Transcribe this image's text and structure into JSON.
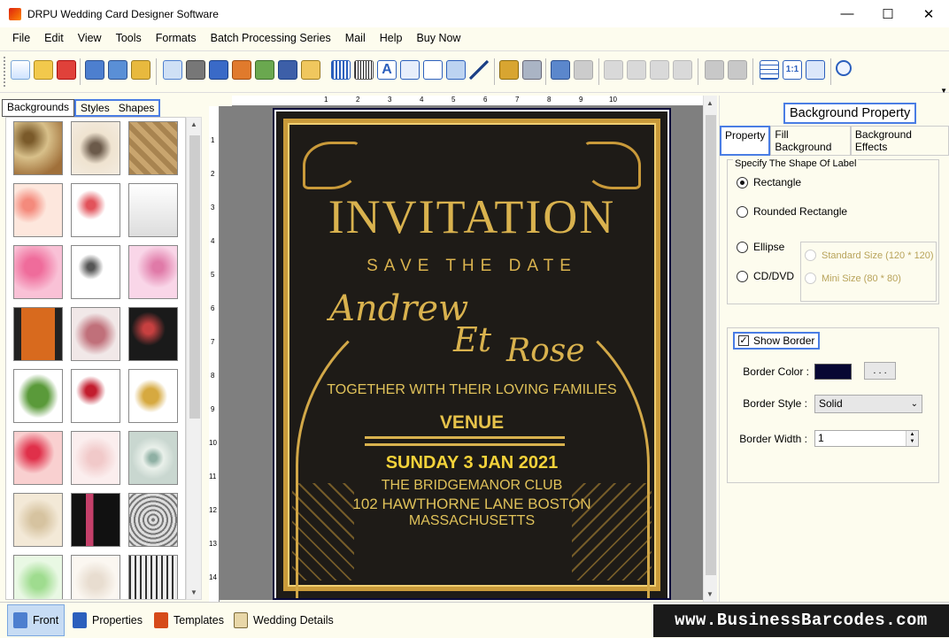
{
  "window": {
    "title": "DRPU Wedding Card Designer Software",
    "minimize": "—",
    "maximize": "☐",
    "close": "✕"
  },
  "menu": [
    "File",
    "Edit",
    "View",
    "Tools",
    "Formats",
    "Batch Processing Series",
    "Mail",
    "Help",
    "Buy Now"
  ],
  "left_tabs": [
    "Backgrounds",
    "Styles",
    "Shapes"
  ],
  "card": {
    "heading": "INVITATION",
    "subheading": "SAVE THE DATE",
    "name1": "Andrew",
    "conjunction": "Et",
    "name2": "Rose",
    "line1": "TOGETHER WITH THEIR LOVING FAMILIES",
    "venue_label": "VENUE",
    "date": "SUNDAY 3 JAN 2021",
    "address1": "THE BRIDGEMANOR CLUB",
    "address2": "102 HAWTHORNE LANE BOSTON",
    "address3": "MASSACHUSETTS",
    "colors": {
      "gold": "#d9b24e",
      "yellow": "#f3d23a",
      "bg": "#1e1b17",
      "border": "#070733"
    }
  },
  "ruler_h": [
    "1",
    "2",
    "3",
    "4",
    "5",
    "6",
    "7",
    "8",
    "9",
    "10"
  ],
  "ruler_v": [
    "1",
    "2",
    "3",
    "4",
    "5",
    "6",
    "7",
    "8",
    "9",
    "10",
    "11",
    "12",
    "13",
    "14"
  ],
  "right_panel": {
    "title": "Background Property",
    "tabs": [
      "Property",
      "Fill Background",
      "Background Effects"
    ],
    "shape_legend": "Specify The Shape Of Label",
    "shapes": [
      "Rectangle",
      "Rounded Rectangle",
      "Ellipse",
      "CD/DVD"
    ],
    "selected_shape": "Rectangle",
    "sizes": [
      "Standard Size (120 * 120)",
      "Mini Size (80 * 80)"
    ],
    "show_border_label": "Show Border",
    "show_border_check": "✓",
    "border_color_label": "Border Color :",
    "border_color_btn": ". . .",
    "border_style_label": "Border Style :",
    "border_style_value": "Solid",
    "border_width_label": "Border Width :",
    "border_width_value": "1"
  },
  "bottom_tabs": [
    "Front",
    "Properties",
    "Templates",
    "Wedding Details"
  ],
  "watermark": "www.BusinessBarcodes.com"
}
